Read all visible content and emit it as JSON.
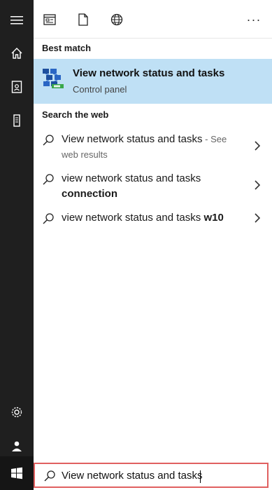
{
  "rail": {
    "icons": [
      "hamburger-menu-icon",
      "home-icon",
      "notebook-icon",
      "device-icon",
      "settings-icon",
      "user-icon",
      "windows-start-icon"
    ]
  },
  "toolbar": {
    "filters": [
      "apps-filter-icon",
      "documents-filter-icon",
      "web-filter-icon"
    ],
    "more_label": "···"
  },
  "best_match": {
    "header": "Best match",
    "title": "View network status and tasks",
    "subtitle": "Control panel",
    "icon": "network-control-panel-icon"
  },
  "web": {
    "header": "Search the web",
    "items": [
      {
        "text": "View network status and tasks",
        "suffix_sep": " - ",
        "suffix": "See web results"
      },
      {
        "text": "view network status and tasks",
        "bold": "connection"
      },
      {
        "text": "view network status and tasks",
        "bold": "w10"
      }
    ]
  },
  "searchbox": {
    "value": "View network status and tasks"
  },
  "colors": {
    "rail_bg": "#1f1f1f",
    "highlight": "#bfe0f5",
    "search_border": "#e06060"
  }
}
